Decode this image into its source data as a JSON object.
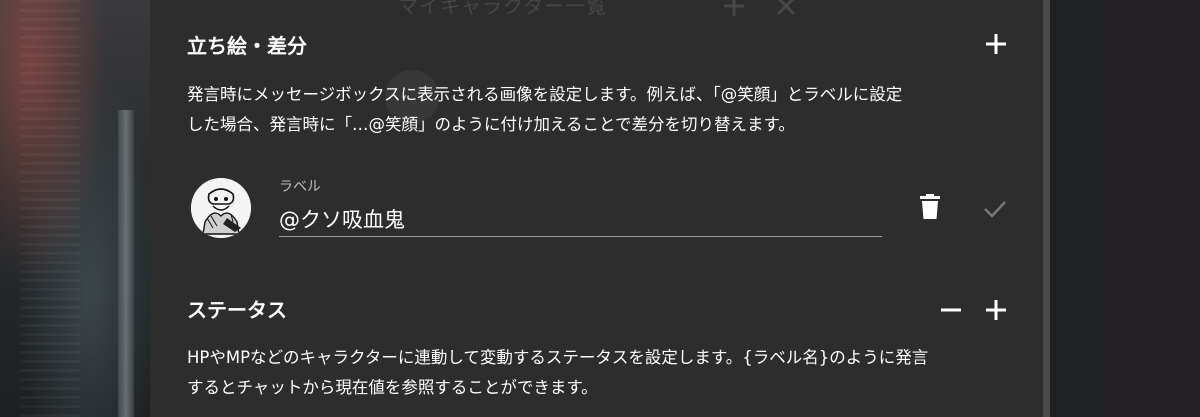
{
  "background_dialog": {
    "title": "マイキャラクター一覧"
  },
  "sections": {
    "standing": {
      "title": "立ち絵・差分",
      "description_line1": "発言時にメッセージボックスに表示される画像を設定します。例えば、「@笑顔」とラベルに設定",
      "description_line2": "した場合、発言時に「…@笑顔」のように付け加えることで差分を切り替えます。",
      "add_icon": "plus-icon",
      "entry": {
        "label_caption": "ラベル",
        "label_value": "@クソ吸血鬼",
        "delete_icon": "trash-icon",
        "confirm_icon": "check-icon"
      }
    },
    "status": {
      "title": "ステータス",
      "description_line1": "HPやMPなどのキャラクターに連動して変動するステータスを設定します。{ラベル名}のように発言",
      "description_line2": "するとチャットから現在値を参照することができます。",
      "remove_icon": "minus-icon",
      "add_icon": "plus-icon"
    }
  },
  "colors": {
    "panel_bg": "#2d2d2d",
    "text": "#ffffff",
    "muted": "#bdbdbd"
  }
}
